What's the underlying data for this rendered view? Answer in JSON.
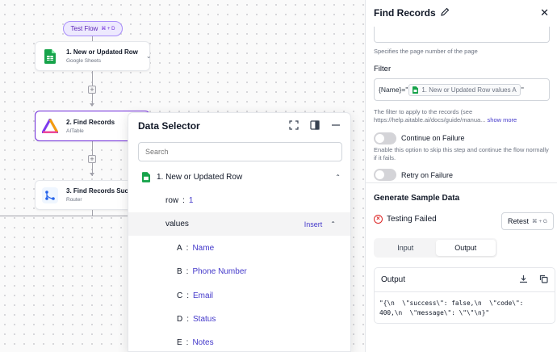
{
  "canvas": {
    "test_flow": {
      "label": "Test Flow",
      "shortcut": "⌘ + D"
    },
    "nodes": [
      {
        "title": "1. New or Updated Row",
        "subtitle": "Google Sheets",
        "icon": "google-sheets-icon"
      },
      {
        "title": "2. Find Records",
        "subtitle": "AITable",
        "icon": "aitable-icon"
      },
      {
        "title": "3. Find Records Succe",
        "subtitle": "Router",
        "icon": "router-icon"
      }
    ],
    "plus_symbol": "+"
  },
  "data_selector": {
    "title": "Data Selector",
    "search_placeholder": "Search",
    "step": {
      "label": "1. New or Updated Row",
      "icon": "google-sheets-icon"
    },
    "rows": [
      {
        "key": "row",
        "sep": ":",
        "value": "1"
      },
      {
        "key": "values",
        "action": "Insert"
      },
      {
        "key": "A",
        "sep": ":",
        "value": "Name"
      },
      {
        "key": "B",
        "sep": ":",
        "value": "Phone Number"
      },
      {
        "key": "C",
        "sep": ":",
        "value": "Email"
      },
      {
        "key": "D",
        "sep": ":",
        "value": "Status"
      },
      {
        "key": "E",
        "sep": ":",
        "value": "Notes"
      }
    ]
  },
  "panel": {
    "title": "Find Records",
    "page_hint": "Specifies the page number of the page",
    "filter_label": "Filter",
    "filter_prefix": "{Name}=\"",
    "filter_chip": "1. New or Updated Row values A",
    "filter_suffix": "\"",
    "filter_hint": "The filter to apply to the records (see https://help.aitable.ai/docs/guide/manua...",
    "show_more": "show more",
    "continue_on_failure": "Continue on Failure",
    "continue_hint": "Enable this option to skip this step and continue the flow normally if it fails.",
    "retry_on_failure": "Retry on Failure",
    "sample_title": "Generate Sample Data",
    "status": "Testing Failed",
    "retest_label": "Retest",
    "retest_shortcut": "⌘ + G",
    "tabs": [
      "Input",
      "Output"
    ],
    "active_tab": "Output",
    "output_title": "Output",
    "output_line1": "\"{\\n  \\\"success\\\": false,\\n  \\\"code\\\":",
    "output_line2": "400,\\n  \\\"message\\\": \\\"\\\"\\n}\""
  },
  "colors": {
    "accent": "#6d28d9",
    "link": "#4338ca",
    "error": "#dc2626"
  }
}
